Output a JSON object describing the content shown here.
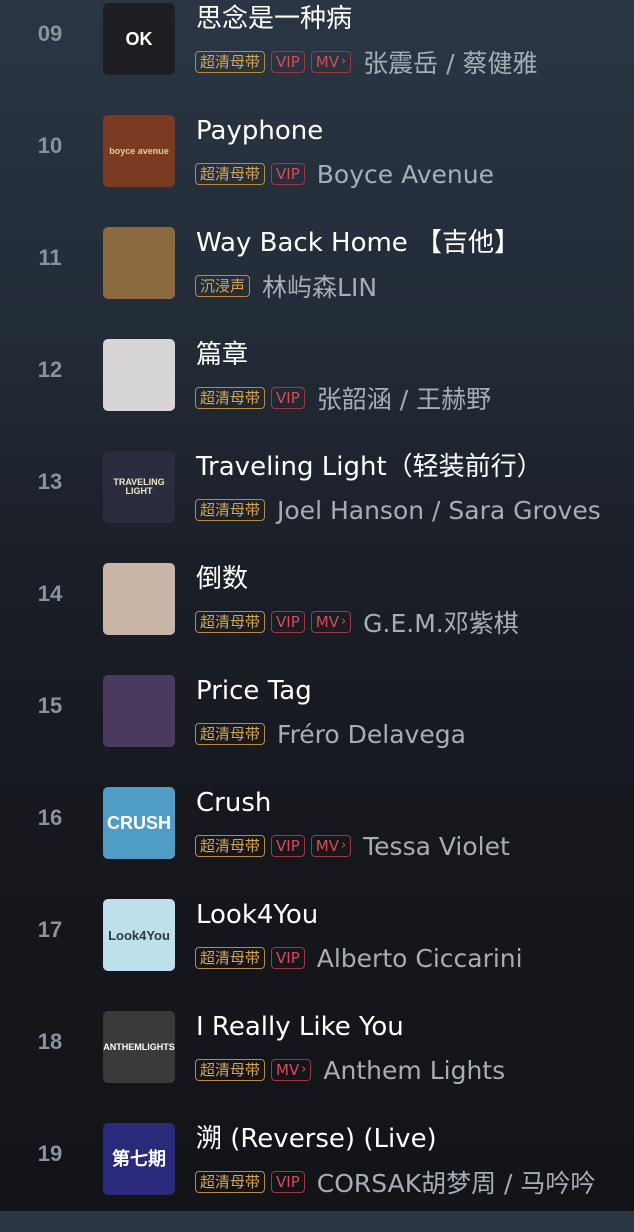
{
  "songs": [
    {
      "rank": "09",
      "title": "思念是一种病",
      "tags": [
        "超清母带",
        "VIP",
        "MV"
      ],
      "artist": "张震岳 / 蔡健雅",
      "cover": {
        "label": "OK",
        "icon": "album-cover",
        "bg": "#1d1f22",
        "fg": "#ffffff"
      }
    },
    {
      "rank": "10",
      "title": "Payphone",
      "tags": [
        "超清母带",
        "VIP"
      ],
      "artist": "Boyce Avenue",
      "cover": {
        "label": "boyce avenue",
        "icon": "album-cover",
        "bg": "#7a3b22",
        "fg": "#e9c9a0"
      }
    },
    {
      "rank": "11",
      "title": "Way Back Home 【吉他】",
      "tags": [
        "沉浸声"
      ],
      "artist": "林屿森LIN",
      "cover": {
        "label": "",
        "icon": "album-cover",
        "bg": "#8a6a3e",
        "fg": "#f1d79a"
      }
    },
    {
      "rank": "12",
      "title": "篇章",
      "tags": [
        "超清母带",
        "VIP"
      ],
      "artist": "张韶涵 / 王赫野",
      "cover": {
        "label": "",
        "icon": "album-cover",
        "bg": "#d8d6d4",
        "fg": "#222222"
      }
    },
    {
      "rank": "13",
      "title": "Traveling Light（轻装前行）",
      "tags": [
        "超清母带"
      ],
      "artist": "Joel Hanson / Sara Groves",
      "cover": {
        "label": "TRAVELING LIGHT",
        "icon": "album-cover",
        "bg": "#2a2d3e",
        "fg": "#f0e6c8"
      }
    },
    {
      "rank": "14",
      "title": "倒数",
      "tags": [
        "超清母带",
        "VIP",
        "MV"
      ],
      "artist": "G.E.M.邓紫棋",
      "cover": {
        "label": "",
        "icon": "album-cover",
        "bg": "#c9b6a6",
        "fg": "#2a1f1a"
      }
    },
    {
      "rank": "15",
      "title": "Price Tag",
      "tags": [
        "超清母带"
      ],
      "artist": "Fréro Delavega",
      "cover": {
        "label": "",
        "icon": "album-cover",
        "bg": "#4a3a5e",
        "fg": "#e8e2f0"
      }
    },
    {
      "rank": "16",
      "title": "Crush",
      "tags": [
        "超清母带",
        "VIP",
        "MV"
      ],
      "artist": "Tessa Violet",
      "cover": {
        "label": "CRUSH",
        "icon": "album-cover",
        "bg": "#4f9cc4",
        "fg": "#ffffff"
      }
    },
    {
      "rank": "17",
      "title": "Look4You",
      "tags": [
        "超清母带",
        "VIP"
      ],
      "artist": "Alberto Ciccarini",
      "cover": {
        "label": "Look4You",
        "icon": "album-cover",
        "bg": "#bfe0ea",
        "fg": "#2b3a44"
      }
    },
    {
      "rank": "18",
      "title": "I Really Like You",
      "tags": [
        "超清母带",
        "MV"
      ],
      "artist": "Anthem Lights",
      "cover": {
        "label": "ANTHEMLIGHTS",
        "icon": "album-cover",
        "bg": "#3a3a3a",
        "fg": "#ffffff"
      }
    },
    {
      "rank": "19",
      "title": "溯 (Reverse) (Live)",
      "tags": [
        "超清母带",
        "VIP"
      ],
      "artist": "CORSAK胡梦周 / 马吟吟",
      "cover": {
        "label": "第七期",
        "icon": "album-cover",
        "bg": "#2b2a7a",
        "fg": "#ffffff"
      }
    }
  ],
  "colors": {
    "gold_tag": "#d4a64e",
    "red_tag": "#d94b56",
    "artist": "#a7adb5",
    "rank": "#8a929c"
  }
}
